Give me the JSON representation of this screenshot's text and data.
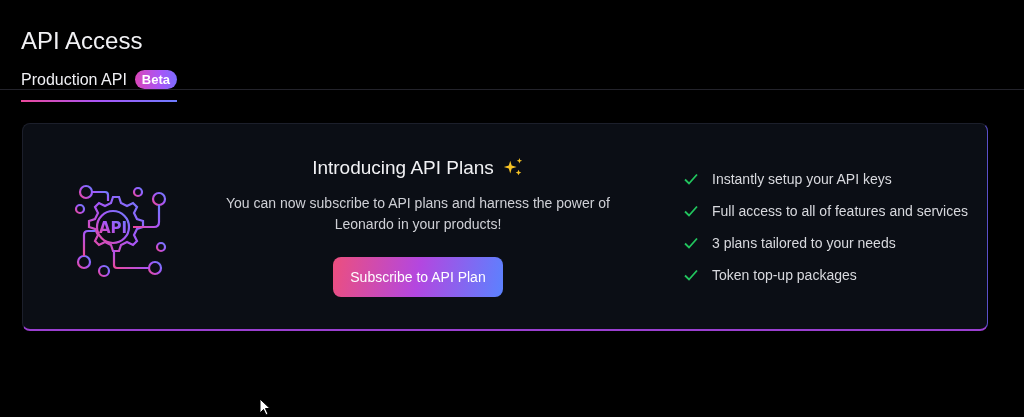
{
  "page_title": "API Access",
  "tabs": [
    {
      "label": "Production API",
      "badge": "Beta",
      "selected": true
    }
  ],
  "promo": {
    "icon_label": "API",
    "heading": "Introducing API Plans",
    "text": "You can now subscribe to API plans and harness the power of Leonardo in your products!",
    "button": "Subscribe to API Plan",
    "features": [
      {
        "text": "Instantly setup your API keys",
        "checked": true
      },
      {
        "text": "Full access to all of features and services",
        "checked": true
      },
      {
        "text": "3 plans tailored to your needs",
        "checked": true
      },
      {
        "text": "Token top-up packages",
        "checked": true
      }
    ]
  }
}
